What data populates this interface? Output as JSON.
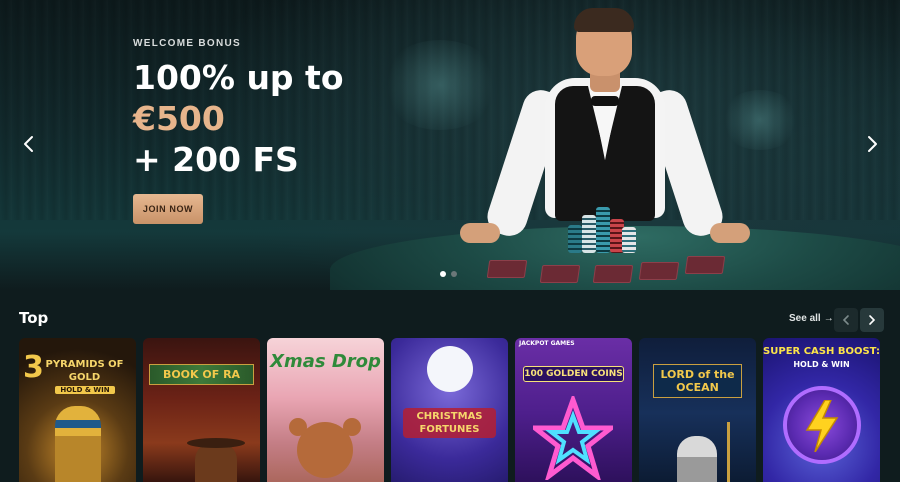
{
  "hero": {
    "eyebrow": "WELCOME BONUS",
    "line1": "100% up to",
    "line2": "€500",
    "line3": "+ 200 FS",
    "cta": "JOIN NOW",
    "slides": 2,
    "active_slide": 1
  },
  "top_section": {
    "title": "Top",
    "see_all": "See all",
    "see_all_arrow": "→"
  },
  "games": [
    {
      "title": "PYRAMIDS OF GOLD",
      "title_prefix": "3",
      "subtitle": "HOLD & WIN"
    },
    {
      "title": "BOOK OF RA"
    },
    {
      "title": "Xmas Drop"
    },
    {
      "title": "CHRISTMAS FORTUNES"
    },
    {
      "badge": "JACKPOT GAMES",
      "title": "100 GOLDEN COINS"
    },
    {
      "title": "LORD of the OCEAN"
    },
    {
      "title": "SUPER CASH BOOST:",
      "subtitle": "HOLD & WIN"
    }
  ],
  "colors": {
    "accent_gold": "#e7b58c",
    "background": "#0f1c1e"
  }
}
